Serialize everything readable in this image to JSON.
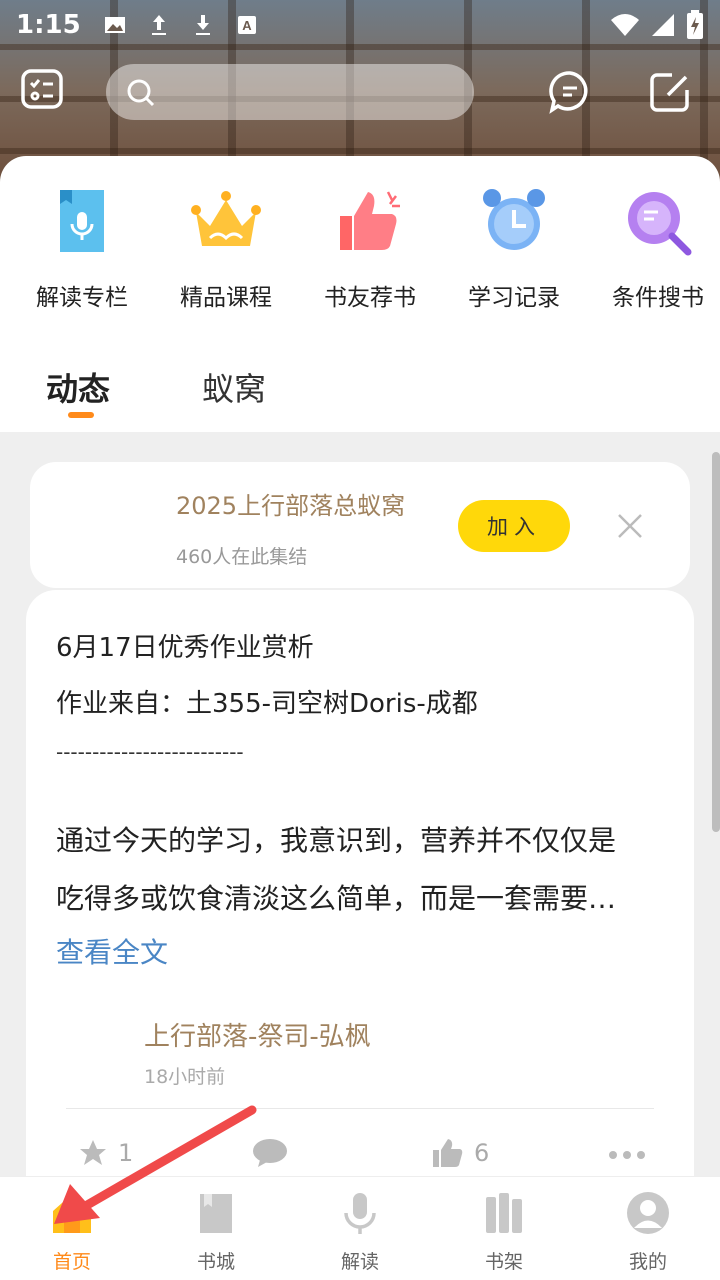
{
  "status_bar": {
    "time": "1:15"
  },
  "quick_access": [
    {
      "label": "解读专栏",
      "icon": "microphone-book-icon"
    },
    {
      "label": "精品课程",
      "icon": "crown-icon"
    },
    {
      "label": "书友荐书",
      "icon": "thumbs-up-icon"
    },
    {
      "label": "学习记录",
      "icon": "alarm-clock-icon"
    },
    {
      "label": "条件搜书",
      "icon": "search-book-icon"
    }
  ],
  "tabs": [
    {
      "label": "动态",
      "active": true
    },
    {
      "label": "蚁窝",
      "active": false
    }
  ],
  "group_card": {
    "title": "2025上行部落总蚁窝",
    "subtitle": "460人在此集结",
    "join_label": "加入"
  },
  "post": {
    "line1": "6月17日优秀作业赏析",
    "line2": "作业来自：土355-司空树Doris-成都",
    "line3": "--------------------------",
    "line4": "通过今天的学习，我意识到，营养并不仅仅是",
    "line5": "吃得多或饮食清淡这么简单，而是一套需要…",
    "read_more": "查看全文",
    "author": "上行部落-祭司-弘枫",
    "time": "18小时前",
    "star_count": "1",
    "like_count": "6"
  },
  "bottom_nav": [
    {
      "label": "首页",
      "active": true
    },
    {
      "label": "书城",
      "active": false
    },
    {
      "label": "解读",
      "active": false
    },
    {
      "label": "书架",
      "active": false
    },
    {
      "label": "我的",
      "active": false
    }
  ],
  "colors": {
    "accent": "#ff8a1a",
    "join": "#ffd80a",
    "link": "#4a86c5",
    "brown": "#a0825e"
  }
}
